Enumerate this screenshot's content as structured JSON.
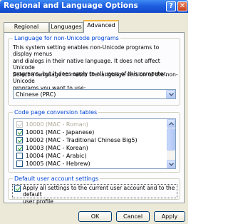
{
  "window": {
    "title": "Regional and Language Options",
    "help_glyph": "?",
    "close_glyph": "✕"
  },
  "tabs": [
    "Regional Options",
    "Languages",
    "Advanced"
  ],
  "active_tab": "Advanced",
  "non_unicode": {
    "legend": "Language for non-Unicode programs",
    "description": [
      "This system setting enables non-Unicode programs to display menus",
      "and dialogs in their native language. It does not affect Unicode",
      "programs, but it does apply to all users of this computer."
    ],
    "select_prompt": [
      "Select a language to match the language version of the non-Unicode",
      "programs you want to use:"
    ],
    "selected_language": "Chinese (PRC)"
  },
  "code_pages": {
    "legend": "Code page conversion tables",
    "items": [
      {
        "label": "10000 (MAC - Roman)",
        "checked": true,
        "disabled": true
      },
      {
        "label": "10001 (MAC - Japanese)",
        "checked": true,
        "disabled": false
      },
      {
        "label": "10002 (MAC - Traditional Chinese Big5)",
        "checked": true,
        "disabled": false
      },
      {
        "label": "10003 (MAC - Korean)",
        "checked": true,
        "disabled": false
      },
      {
        "label": "10004 (MAC - Arabic)",
        "checked": false,
        "disabled": false
      },
      {
        "label": "10005 (MAC - Hebrew)",
        "checked": false,
        "disabled": false
      }
    ]
  },
  "default_user": {
    "legend": "Default user account settings",
    "checkbox_lines": [
      "Apply all settings to the current user account and to the default",
      "user profile"
    ],
    "checked": true
  },
  "buttons": {
    "ok": "OK",
    "cancel": "Cancel",
    "apply": "Apply"
  },
  "colors": {
    "titlebar": "#1f5fe0",
    "group_legend": "#0046d5",
    "check": "#21a121",
    "tab_highlight": "#f4b73f"
  }
}
